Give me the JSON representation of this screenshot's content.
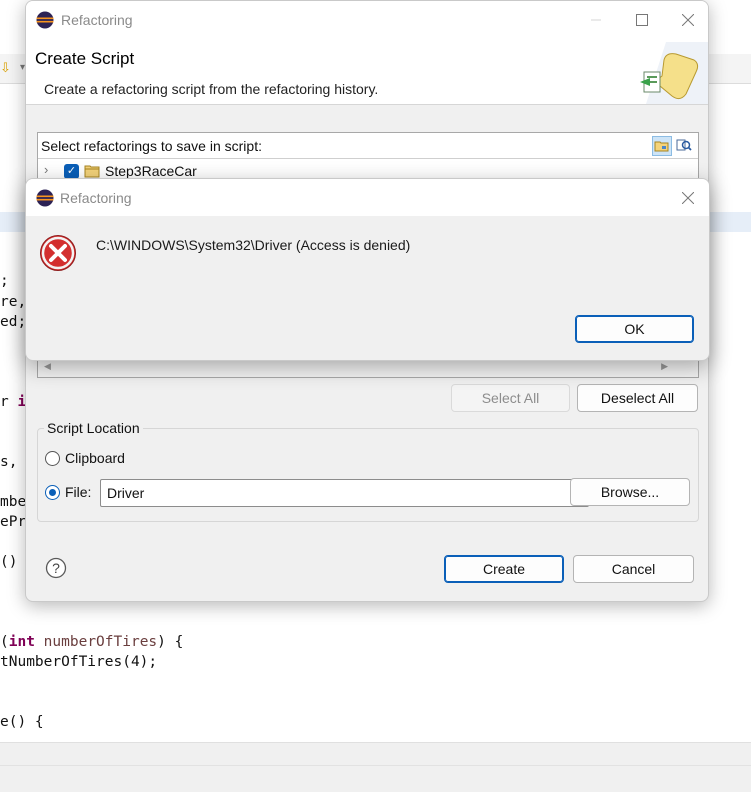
{
  "editor": {
    "code_lines": [
      {
        "text": ";"
      },
      {
        "text": "re,"
      },
      {
        "text": "ed;"
      },
      {
        "kw": "",
        "text": "",
        "partial": "r ",
        "kwtext": "in"
      },
      {
        "text": "s,"
      },
      {
        "text": "mbe"
      },
      {
        "text": "ePr"
      },
      {
        "text": "()"
      },
      {
        "text": "(int numberOfTires) {"
      },
      {
        "text": "tNumberOfTires(4);"
      },
      {
        "text": "e() {"
      }
    ]
  },
  "main_dialog": {
    "window_title": "Refactoring",
    "header_title": "Create Script",
    "header_desc": "Create a refactoring script from the refactoring history.",
    "tree_label": "Select refactorings to save in script:",
    "tree_item": "Step3RaceCar",
    "select_all": "Select All",
    "deselect_all": "Deselect All",
    "group_label": "Script Location",
    "clipboard_label": "Clipboard",
    "file_label": "File:",
    "file_value": "Driver",
    "browse": "Browse...",
    "create": "Create",
    "cancel": "Cancel"
  },
  "error_dialog": {
    "window_title": "Refactoring",
    "message": "C:\\WINDOWS\\System32\\Driver (Access is denied)",
    "ok": "OK"
  },
  "colors": {
    "accent": "#0a5fb8",
    "error_red": "#d32f2f"
  },
  "icons": [
    "eclipse-icon",
    "minimize-icon",
    "maximize-icon",
    "close-icon",
    "wizard-scroll-icon",
    "group-by-project-icon",
    "filter-icon",
    "chevron-right-icon",
    "folder-icon",
    "chevron-down-icon",
    "help-icon",
    "error-icon"
  ]
}
